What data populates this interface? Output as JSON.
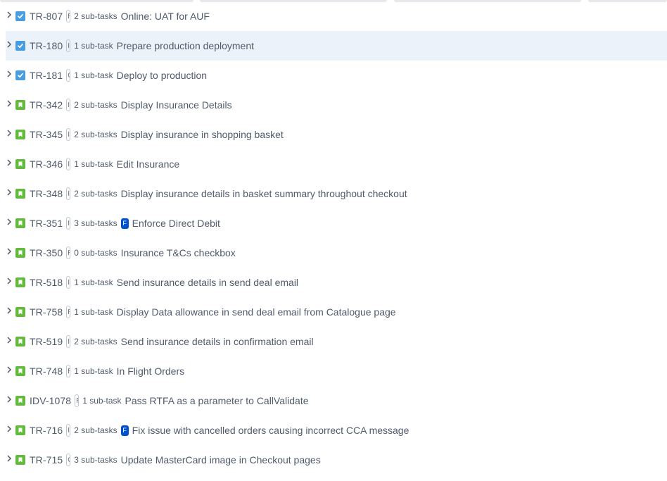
{
  "issues": [
    {
      "key": "TR-807",
      "type": "task",
      "status": "R",
      "subtasks": "2 sub-tasks",
      "epic": "",
      "summary": "Online: UAT for AUF",
      "selected": false
    },
    {
      "key": "TR-180",
      "type": "task",
      "status": "I",
      "subtasks": "1 sub-task",
      "epic": "",
      "summary": "Prepare production deployment",
      "selected": true
    },
    {
      "key": "TR-181",
      "type": "task",
      "status": "C",
      "subtasks": "1 sub-task",
      "epic": "",
      "summary": "Deploy to production",
      "selected": false
    },
    {
      "key": "TR-342",
      "type": "story",
      "status": "I",
      "subtasks": "2 sub-tasks",
      "epic": "",
      "summary": "Display Insurance Details",
      "selected": false
    },
    {
      "key": "TR-345",
      "type": "story",
      "status": "I",
      "subtasks": "2 sub-tasks",
      "epic": "",
      "summary": "Display insurance in shopping basket",
      "selected": false
    },
    {
      "key": "TR-346",
      "type": "story",
      "status": "I",
      "subtasks": "1 sub-task",
      "epic": "",
      "summary": "Edit Insurance",
      "selected": false
    },
    {
      "key": "TR-348",
      "type": "story",
      "status": "I",
      "subtasks": "2 sub-tasks",
      "epic": "",
      "summary": "Display insurance details in basket summary throughout checkout",
      "selected": false
    },
    {
      "key": "TR-351",
      "type": "story",
      "status": "I",
      "subtasks": "3 sub-tasks",
      "epic": "F",
      "summary": "Enforce Direct Debit",
      "selected": false
    },
    {
      "key": "TR-350",
      "type": "story",
      "status": "R",
      "subtasks": "0 sub-tasks",
      "epic": "",
      "summary": "Insurance T&Cs checkbox",
      "selected": false
    },
    {
      "key": "TR-518",
      "type": "story",
      "status": "I",
      "subtasks": "1 sub-task",
      "epic": "",
      "summary": "Send insurance details in send deal email",
      "selected": false
    },
    {
      "key": "TR-758",
      "type": "story",
      "status": "R",
      "subtasks": "1 sub-task",
      "epic": "",
      "summary": "Display Data allowance in send deal email from Catalogue page",
      "selected": false
    },
    {
      "key": "TR-519",
      "type": "story",
      "status": "I",
      "subtasks": "2 sub-tasks",
      "epic": "",
      "summary": "Send insurance details in confirmation email",
      "selected": false
    },
    {
      "key": "TR-748",
      "type": "story",
      "status": "R",
      "subtasks": "1 sub-task",
      "epic": "",
      "summary": "In Flight Orders",
      "selected": false
    },
    {
      "key": "IDV-1078",
      "type": "story",
      "status": "R",
      "subtasks": "1 sub-task",
      "epic": "",
      "summary": "Pass RTFA as a parameter to CallValidate",
      "selected": false
    },
    {
      "key": "TR-716",
      "type": "story",
      "status": "I",
      "subtasks": "2 sub-tasks",
      "epic": "F",
      "summary": "Fix issue with cancelled orders causing incorrect CCA message",
      "selected": false
    },
    {
      "key": "TR-715",
      "type": "story",
      "status": "C",
      "subtasks": "3 sub-tasks",
      "epic": "",
      "summary": "Update MasterCard image in Checkout pages",
      "selected": false
    }
  ],
  "colors": {
    "task_icon": "#4a9ce0",
    "story_icon": "#63ba3c",
    "epic": "#0052cc",
    "selected_row": "#ebf2f9"
  }
}
